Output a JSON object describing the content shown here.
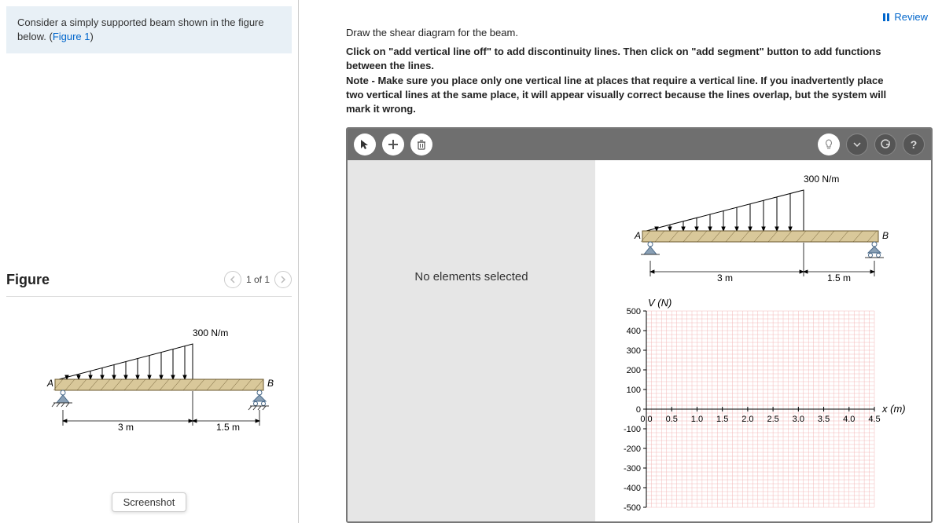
{
  "problem": {
    "text_before_link": "Consider a simply supported beam shown in the figure below. (",
    "link_text": "Figure 1",
    "text_after_link": ")"
  },
  "figure": {
    "title": "Figure",
    "pager": "1 of 1",
    "load_label": "300 N/m",
    "dim1": "3 m",
    "dim2": "1.5 m",
    "lbl_A": "A",
    "lbl_B": "B",
    "screenshot_label": "Screenshot"
  },
  "review_label": "Review",
  "instructions": {
    "line1": "Draw the shear diagram for the beam.",
    "line2": "Click on \"add vertical line off\" to add discontinuity lines. Then click on \"add segment\" button to add functions between the lines.",
    "line3": "Note - Make sure you place only one vertical line at places that require a vertical line. If you inadvertently place two vertical lines at the same place, it will appear visually correct because the lines overlap, but the system will mark it wrong."
  },
  "drawing": {
    "no_selection": "No elements selected",
    "load_label": "300 N/m",
    "dim1": "3 m",
    "dim2": "1.5 m",
    "lbl_A": "A",
    "lbl_B": "B",
    "y_axis_label": "V (N)",
    "x_axis_label": "x (m)"
  },
  "chart_data": {
    "type": "line",
    "title": "",
    "xlabel": "x (m)",
    "ylabel": "V (N)",
    "xlim": [
      0.0,
      4.5
    ],
    "ylim": [
      -500,
      500
    ],
    "x_ticks": [
      0.0,
      0.5,
      1.0,
      1.5,
      2.0,
      2.5,
      3.0,
      3.5,
      4.0,
      4.5
    ],
    "y_ticks": [
      -500,
      -400,
      -300,
      -200,
      -100,
      0,
      100,
      200,
      300,
      400,
      500
    ],
    "series": []
  },
  "beam": {
    "peak_load_Npm": 300,
    "span1_m": 3,
    "span2_m": 1.5,
    "supports": [
      "pin-A",
      "roller-B"
    ]
  }
}
